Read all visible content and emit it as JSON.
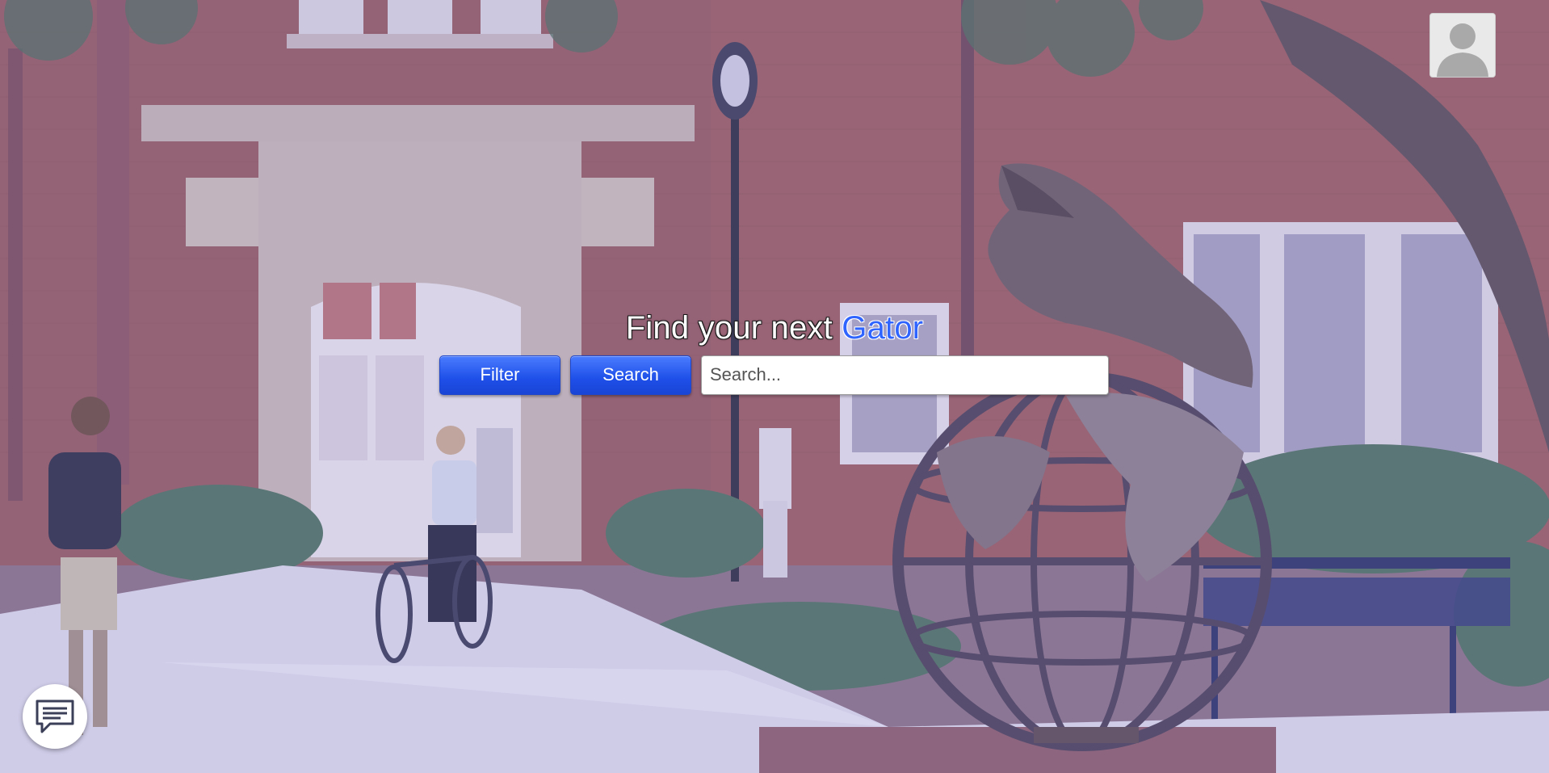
{
  "hero": {
    "title_prefix": "Find your next ",
    "title_accent": "Gator",
    "accent_color": "#2f64ff"
  },
  "search": {
    "filter_label": "Filter",
    "search_label": "Search",
    "placeholder": "Search...",
    "value": "",
    "button_color": "#1e4fe8"
  },
  "header": {
    "avatar_icon": "user-avatar-icon"
  },
  "widgets": {
    "chat_icon": "chat-bubble-icon"
  },
  "background": {
    "scene": "campus-courtyard-photo",
    "tint_color": "#9696e6"
  }
}
